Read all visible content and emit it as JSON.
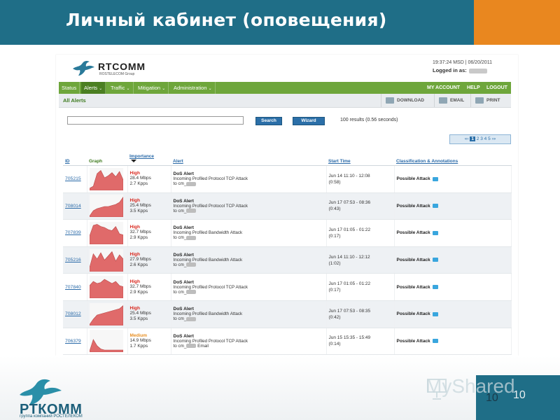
{
  "slide": {
    "title": "Личный кабинет (оповещения)",
    "page_number": "10",
    "page_number_shadow": "10",
    "watermark": "MyShared",
    "footer_logo_text": "РТКОММ",
    "footer_logo_sub": "группа компаний РОСТЕЛЕКОМ"
  },
  "app": {
    "logo_name": "RTCOMM",
    "logo_sub": "ROSTELECOM Group",
    "clock": "19:37:24 MSD | 06/20/2011",
    "logged_in_label": "Logged in as:",
    "nav": [
      "Status",
      "Alerts",
      "Traffic",
      "Mitigation",
      "Administration"
    ],
    "nav_active": "Alerts",
    "nav_right": [
      "MY ACCOUNT",
      "HELP",
      "LOGOUT"
    ],
    "section_title": "All Alerts",
    "tools": [
      "DOWNLOAD",
      "EMAIL",
      "PRINT"
    ],
    "search_button": "Search",
    "wizard_button": "Wizard",
    "results_text": "100 results (0.56 seconds)",
    "pager": {
      "prev": "«‹",
      "current": "1",
      "pages": [
        "2",
        "3",
        "4",
        "5"
      ],
      "next": "›»"
    }
  },
  "table": {
    "headers": {
      "id": "ID",
      "graph": "Graph",
      "importance": "Importance",
      "alert": "Alert",
      "start_time": "Start Time",
      "classification": "Classification & Annotations"
    },
    "rows": [
      {
        "id": "705215",
        "severity": "High",
        "rate": "28.4 Mbps",
        "pps": "2.7 Kpps",
        "title": "DoS Alert",
        "desc": "Incoming Profiled Protocol TCP Attack",
        "to_prefix": "to cm_",
        "to_suffix": "",
        "time": "Jun 14 11:10 - 12:08",
        "duration": "(0:58)",
        "classification": "Possible Attack",
        "graph": [
          0.1,
          0.2,
          0.8,
          0.95,
          0.6,
          0.7,
          0.85,
          0.65,
          0.9,
          0.5
        ]
      },
      {
        "id": "708014",
        "severity": "High",
        "rate": "25.4 Mbps",
        "pps": "3.5 Kpps",
        "title": "DoS Alert",
        "desc": "Incoming Profiled Protocol TCP Attack",
        "to_prefix": "to cm_",
        "to_suffix": "",
        "time": "Jun 17 07:53 - 08:36",
        "duration": "(0:43)",
        "classification": "Possible Attack",
        "graph": [
          0.05,
          0.3,
          0.4,
          0.45,
          0.5,
          0.5,
          0.55,
          0.6,
          0.7,
          0.95
        ]
      },
      {
        "id": "707839",
        "severity": "High",
        "rate": "32.7 Mbps",
        "pps": "2.9 Kpps",
        "title": "DoS Alert",
        "desc": "Incoming Profiled Bandwidth Attack",
        "to_prefix": "to cm_",
        "to_suffix": "",
        "time": "Jun 17 01:05 - 01:22",
        "duration": "(0:17)",
        "classification": "Possible Attack",
        "graph": [
          0.4,
          0.9,
          0.95,
          0.85,
          0.8,
          0.7,
          0.65,
          0.85,
          0.5,
          0.45
        ]
      },
      {
        "id": "705216",
        "severity": "High",
        "rate": "27.9 Mbps",
        "pps": "2.6 Kpps",
        "title": "DoS Alert",
        "desc": "Incoming Profiled Bandwidth Attack",
        "to_prefix": "to cm_",
        "to_suffix": "",
        "time": "Jun 14 11:10 - 12:12",
        "duration": "(1:02)",
        "classification": "Possible Attack",
        "graph": [
          0.2,
          0.85,
          0.6,
          0.9,
          0.55,
          0.75,
          0.95,
          0.5,
          0.8,
          0.6
        ]
      },
      {
        "id": "707840",
        "severity": "High",
        "rate": "32.7 Mbps",
        "pps": "2.9 Kpps",
        "title": "DoS Alert",
        "desc": "Incoming Profiled Protocol TCP Attack",
        "to_prefix": "to cm_",
        "to_suffix": "",
        "time": "Jun 17 01:05 - 01:22",
        "duration": "(0:17)",
        "classification": "Possible Attack",
        "graph": [
          0.6,
          0.8,
          0.7,
          0.75,
          0.9,
          0.8,
          0.7,
          0.8,
          0.6,
          0.55
        ]
      },
      {
        "id": "708012",
        "severity": "High",
        "rate": "25.4 Mbps",
        "pps": "3.5 Kpps",
        "title": "DoS Alert",
        "desc": "Incoming Profiled Bandwidth Attack",
        "to_prefix": "to cm_",
        "to_suffix": "",
        "time": "Jun 17 07:53 - 08:35",
        "duration": "(0:42)",
        "classification": "Possible Attack",
        "graph": [
          0.05,
          0.3,
          0.5,
          0.55,
          0.6,
          0.65,
          0.7,
          0.75,
          0.8,
          0.95
        ]
      },
      {
        "id": "706379",
        "severity": "Medium",
        "rate": "14.9 Mbps",
        "pps": "1.7 Kpps",
        "title": "DoS Alert",
        "desc": "Incoming Profiled Protocol TCP Attack",
        "to_prefix": "to cm_",
        "to_suffix": "Email",
        "time": "Jun 15 15:35 - 15:49",
        "duration": "(0:14)",
        "classification": "Possible Attack",
        "graph": [
          0.05,
          0.6,
          0.3,
          0.15,
          0.1,
          0.1,
          0.1,
          0.1,
          0.1,
          0.1
        ]
      }
    ]
  },
  "colors": {
    "slide_header": "#1f6e87",
    "slide_accent": "#e9871f",
    "nav_green": "#6ea63b",
    "severity_high": "#d8261c",
    "severity_medium": "#e89024",
    "graph_fill": "#e06a6a",
    "link_blue": "#2a6aa8"
  },
  "icons": {
    "download": "download-icon",
    "email": "email-icon",
    "print": "print-icon",
    "annotation": "annotation-icon",
    "sort": "sort-desc-icon"
  }
}
